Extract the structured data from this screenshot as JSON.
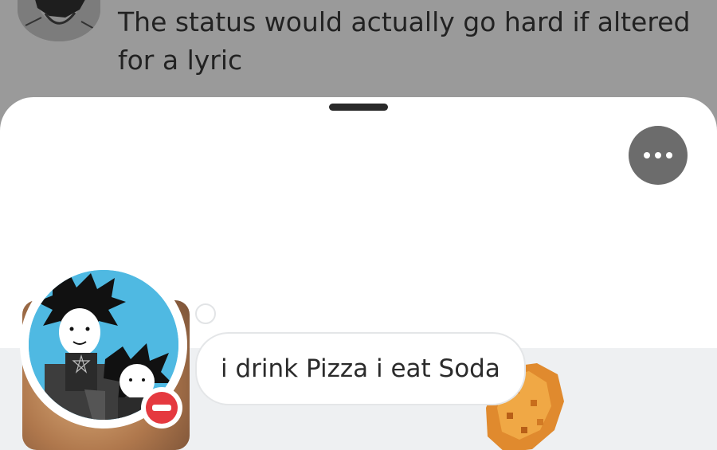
{
  "background_chat": {
    "message_text": "The status would actually go hard if altered for a lyric"
  },
  "profile_sheet": {
    "custom_status": "i drink Pizza i eat Soda",
    "presence": "do-not-disturb",
    "more_button_icon": "more-horizontal-icon"
  },
  "colors": {
    "overlay_dim": "#9a9a9a",
    "sheet_bg": "#ffffff",
    "banner_bg": "#eef0f2",
    "avatar_bg": "#4fb9e2",
    "dnd_red": "#e5393f",
    "more_button_bg": "#6c6c6c"
  }
}
